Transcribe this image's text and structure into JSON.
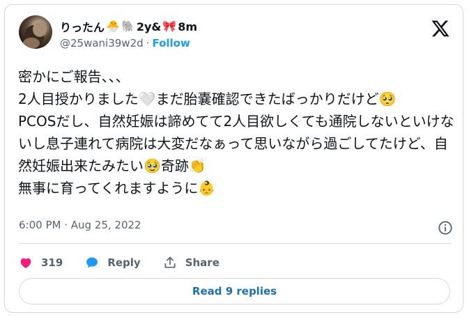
{
  "author": {
    "display_name": "りったん",
    "emoji_1": "🐣",
    "emoji_2": "🐘",
    "label_2y": "2y&",
    "emoji_3": "🎀",
    "label_8m": "8m",
    "handle": "@25wani39w2d",
    "separator": "·",
    "follow_label": "Follow"
  },
  "tweet": {
    "text": "密かにご報告、、、\n2人目授かりました🤍まだ胎嚢確認できたばっかりだけど🥺\nPCOSだし、自然妊娠は諦めてて2人目欲しくても通院しないといけないし息子連れて病院は大変だなぁって思いながら過ごしてたけど、自然妊娠出来たみたい🥹奇跡👏\n無事に育ってくれますように👶"
  },
  "meta": {
    "timestamp": "6:00 PM · Aug 25, 2022"
  },
  "actions": {
    "like_count": "319",
    "reply_label": "Reply",
    "share_label": "Share"
  },
  "replies_button": "Read 9 replies",
  "colors": {
    "like": "#f91880",
    "reply": "#1d9bf0",
    "link": "#1d9bf0",
    "border": "#cfd9de"
  },
  "icons": [
    "x-logo-icon",
    "info-icon",
    "heart-icon",
    "reply-bubble-icon",
    "share-icon"
  ]
}
